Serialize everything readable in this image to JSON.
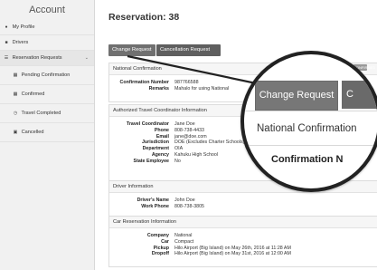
{
  "sidebar": {
    "title": "Account",
    "items": [
      {
        "label": "My Profile",
        "icon": "user-icon"
      },
      {
        "label": "Drivers",
        "icon": "car-icon"
      },
      {
        "label": "Reservation Requests",
        "icon": "list-icon"
      },
      {
        "label": "Pending Confirmation",
        "icon": "calendar-icon"
      },
      {
        "label": "Confirmed",
        "icon": "calendar-icon"
      },
      {
        "label": "Travel Completed",
        "icon": "clock-icon"
      },
      {
        "label": "Cancelled",
        "icon": "trash-icon"
      }
    ]
  },
  "page": {
    "title": "Reservation: 38"
  },
  "actions": {
    "change_request": "Change Request",
    "cancellation_request": "Cancellation Request"
  },
  "sections": {
    "national_confirmation": {
      "title": "National Confirmation",
      "rows": [
        {
          "label": "Confirmation Number",
          "value": "987766588"
        },
        {
          "label": "Remarks",
          "value": "Mahalo for using National"
        }
      ]
    },
    "coordinator": {
      "title": "Authorized Travel Coordinator Information",
      "rows": [
        {
          "label": "Travel Coordinator",
          "value": "Jane Doe"
        },
        {
          "label": "Phone",
          "value": "808-738-4433"
        },
        {
          "label": "Email",
          "value": "jane@doe.com"
        },
        {
          "label": "Jurisdiction",
          "value": "DOE (Excludes Charter Schools)"
        },
        {
          "label": "Department",
          "value": "OIA"
        },
        {
          "label": "Agency",
          "value": "Kahuku High School"
        },
        {
          "label": "State Employee",
          "value": "No"
        }
      ]
    },
    "driver": {
      "title": "Driver Information",
      "rows": [
        {
          "label": "Driver's Name",
          "value": "John Doe"
        },
        {
          "label": "Work Phone",
          "value": "808-738-3805"
        }
      ]
    },
    "car": {
      "title": "Car Reservation Information",
      "rows": [
        {
          "label": "Company",
          "value": "National"
        },
        {
          "label": "Car",
          "value": "Compact"
        },
        {
          "label": "Pickup",
          "value": "Hilo Airport (Big Island) on May 26th, 2016 at 11:28 AM"
        },
        {
          "label": "Dropoff",
          "value": "Hilo Airport (Big Island) on May 31st, 2016 at 12:00 AM"
        }
      ]
    }
  },
  "magnifier": {
    "button_primary": "Change Request",
    "button_secondary_partial": "C",
    "section_title": "National Confirmation",
    "cut_text": "Confirmation N"
  },
  "badge": {
    "label": "CONFIRMED"
  }
}
